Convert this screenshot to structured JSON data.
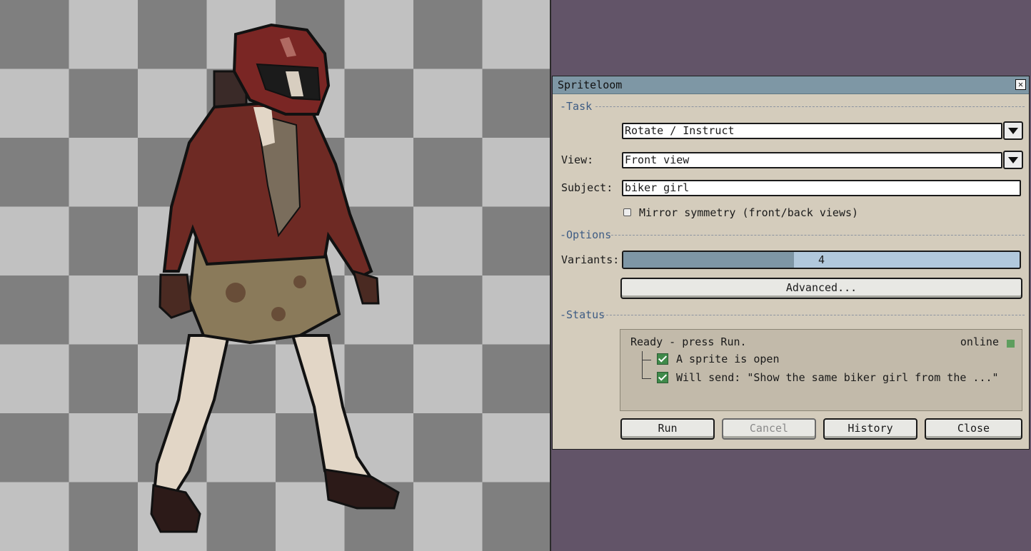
{
  "dialog": {
    "title": "Spriteloom",
    "close_glyph": "✕",
    "sections": {
      "task": "-Task",
      "options": "-Options",
      "status": "-Status"
    },
    "task": {
      "mode_value": "Rotate / Instruct",
      "view_label": "View:",
      "view_value": "Front view",
      "subject_label": "Subject:",
      "subject_value": "biker girl",
      "mirror_label": "Mirror symmetry (front/back views)",
      "mirror_checked": false
    },
    "options": {
      "variants_label": "Variants:",
      "variants_value": "4",
      "variants_fill_fraction": 0.43,
      "advanced_label": "Advanced..."
    },
    "status": {
      "message": "Ready - press Run.",
      "connection": "online",
      "connection_color": "#5e9e5e",
      "checks": [
        {
          "label": "A sprite is open",
          "checked": true
        },
        {
          "label": "Will send: \"Show the same biker girl from the ...\"",
          "checked": true
        }
      ]
    },
    "buttons": {
      "run": "Run",
      "cancel": "Cancel",
      "history": "History",
      "close": "Close"
    }
  },
  "canvas": {
    "checker_light": "#c1c1c1",
    "checker_dark": "#7f7f7f",
    "sprite_subject": "biker girl"
  },
  "colors": {
    "background": "#625468",
    "dialog_bg": "#d4ccbc",
    "titlebar_bg": "#7e97a5",
    "section_text": "#3e5c84"
  }
}
